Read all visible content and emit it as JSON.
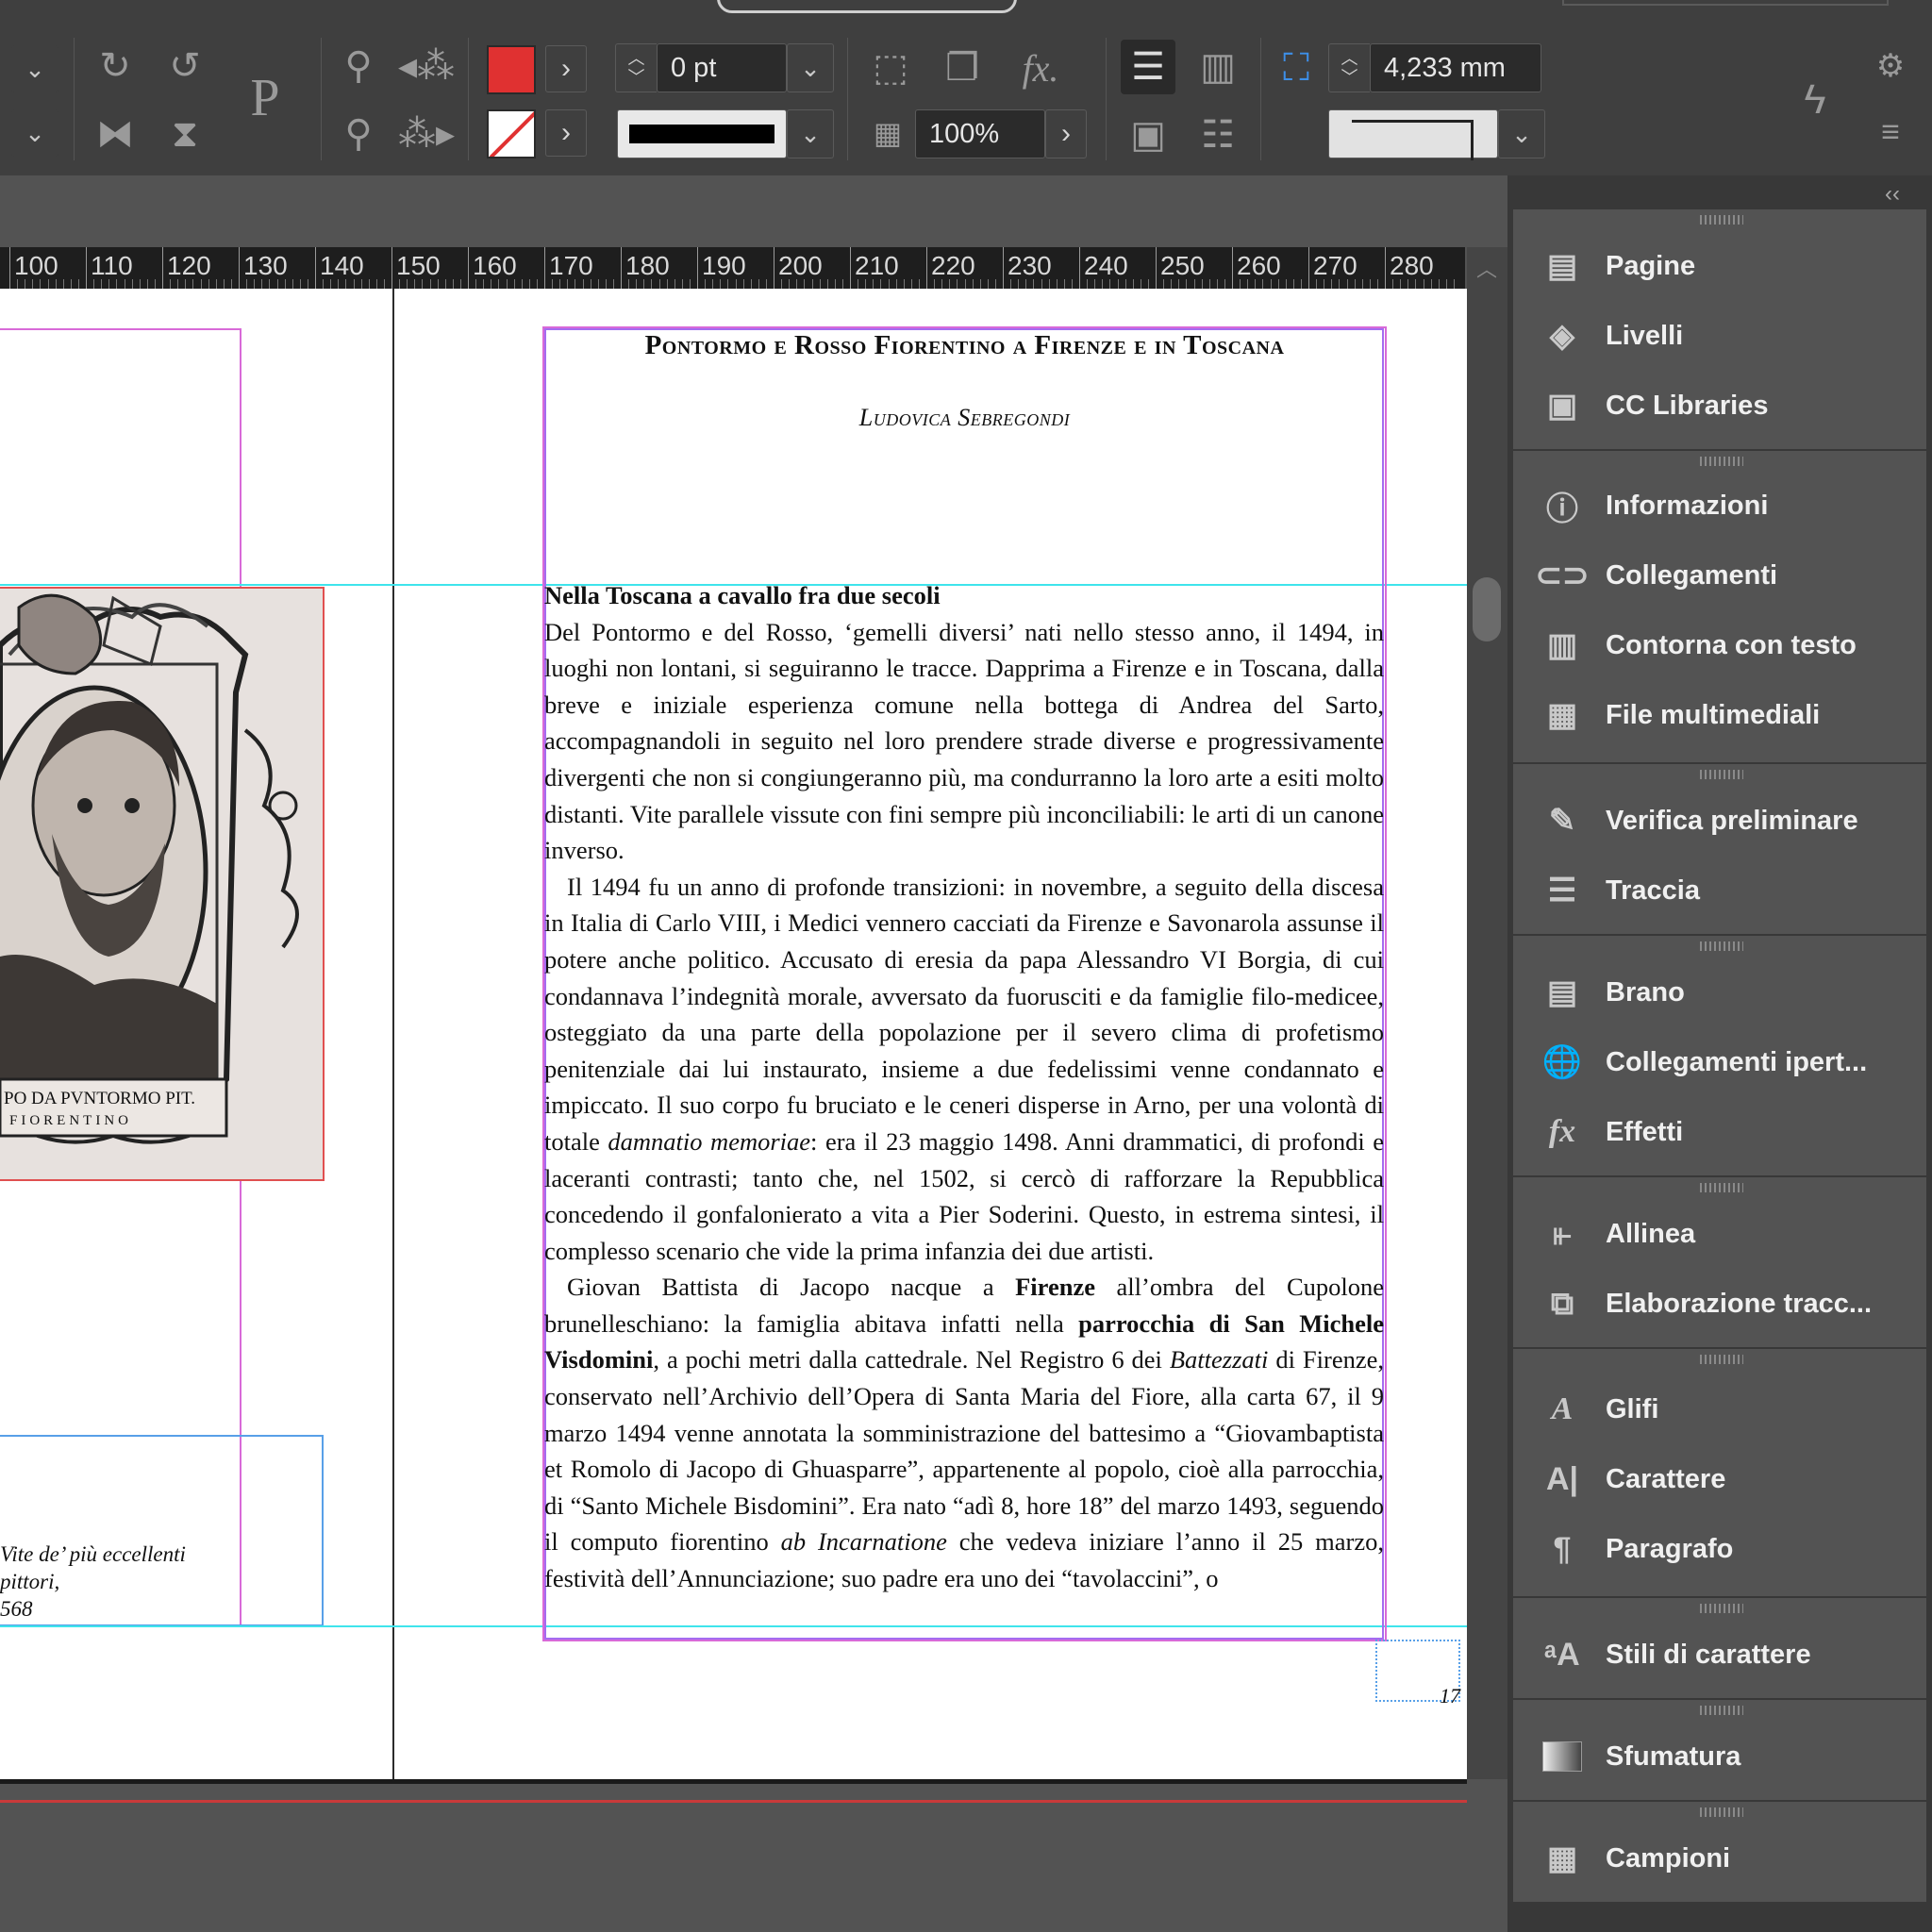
{
  "control_bar": {
    "stroke_weight": "0 pt",
    "opacity": "100%",
    "offset": "4,233 mm",
    "colors": {
      "fill": "#e03131",
      "stroke": "none"
    }
  },
  "ruler": {
    "ticks": [
      "100",
      "110",
      "120",
      "130",
      "140",
      "150",
      "160",
      "170",
      "180",
      "190",
      "200",
      "210",
      "220",
      "230",
      "240",
      "250",
      "260",
      "270",
      "280"
    ]
  },
  "page": {
    "title": "Pontormo e Rosso Fiorentino a Firenze e in Toscana",
    "author": "Ludovica Sebregondi",
    "section_heading": "Nella Toscana a cavallo fra due secoli",
    "para1": "Del Pontormo e del Rosso, ‘gemelli diversi’ nati nello stesso anno, il 1494, in luoghi non lontani, si seguiranno le tracce. Dapprima a Firenze e in Toscana, dalla breve e iniziale esperienza comune nella bottega di Andrea del Sarto, accompagnandoli in seguito nel loro prendere strade diverse e progressivamente divergenti che non si congiungeranno più, ma condurranno la loro arte a esiti molto distanti. Vite parallele vissute con fini sempre più inconciliabili: le arti di un canone inverso.",
    "para2_a": "Il 1494 fu un anno di profonde transizioni: in novembre, a seguito della discesa in Italia di Carlo VIII, i Medici vennero cacciati da Firenze e Savonarola assunse il potere anche politico. Accusato di eresia da papa Alessandro VI Borgia, di cui condannava l’indegnità morale, avversato da fuorusciti e da famiglie filo-medicee, osteggiato da una parte della popolazione per il severo clima di profetismo penitenziale dai lui instaurato, insieme a due fedelissimi venne condannato e impiccato. Il suo corpo fu bruciato e le ceneri disperse in Arno, per una volontà di totale ",
    "para2_italic": "damnatio memoriae",
    "para2_b": ": era il 23 maggio 1498. Anni drammatici, di profondi e laceranti contrasti; tanto che, nel 1502, si cercò di rafforzare la Repubblica concedendo il gonfalonierato a vita a Pier Soderini. Questo, in estrema sintesi, il complesso scenario che vide la prima infanzia dei due artisti.",
    "para3_a": "Giovan Battista di Jacopo nacque a ",
    "para3_bold1": "Firenze",
    "para3_b": " all’ombra del Cupolone brunelleschiano: la famiglia abitava infatti nella ",
    "para3_bold2": "parrocchia di San Michele Visdomini",
    "para3_c": ", a pochi metri dalla cattedrale. Nel Registro 6 dei ",
    "para3_italic1": "Battezzati",
    "para3_d": " di Firenze, conservato nell’Archivio dell’Opera di Santa Maria del Fiore, alla carta 67, il 9 marzo 1494 venne annotata la somministrazione del battesimo a “Giovambaptista et Romolo di Jacopo di Ghuasparre”, appartenente al popolo, cioè alla parrocchia, di “Santo Michele Bisdomini”. Era nato “adì 8, hore 18” del marzo 1493, seguendo il computo fiorentino ",
    "para3_italic2": "ab Incarnatione",
    "para3_e": " che vedeva iniziare l’anno il 25 marzo, festività dell’Annunciazione; suo padre era uno dei “tavolaccini”, o",
    "page_number": "17",
    "illustration_inscription_1": "PO DA PVNTORMO PIT.",
    "illustration_inscription_2": "FIORENTINO",
    "caption_line1": "Vite de’ più eccellenti pittori,",
    "caption_line2": "568"
  },
  "panels": {
    "group1": [
      "Pagine",
      "Livelli",
      "CC Libraries"
    ],
    "group2": [
      "Informazioni",
      "Collegamenti",
      "Contorna con testo",
      "File multimediali"
    ],
    "group3": [
      "Verifica preliminare",
      "Traccia"
    ],
    "group4": [
      "Brano",
      "Collegamenti ipert...",
      "Effetti"
    ],
    "group5": [
      "Allinea",
      "Elaborazione tracc..."
    ],
    "group6": [
      "Glifi",
      "Carattere",
      "Paragrafo"
    ],
    "group7": [
      "Stili di carattere"
    ],
    "group8": [
      "Sfumatura"
    ],
    "group9": [
      "Campioni"
    ]
  }
}
